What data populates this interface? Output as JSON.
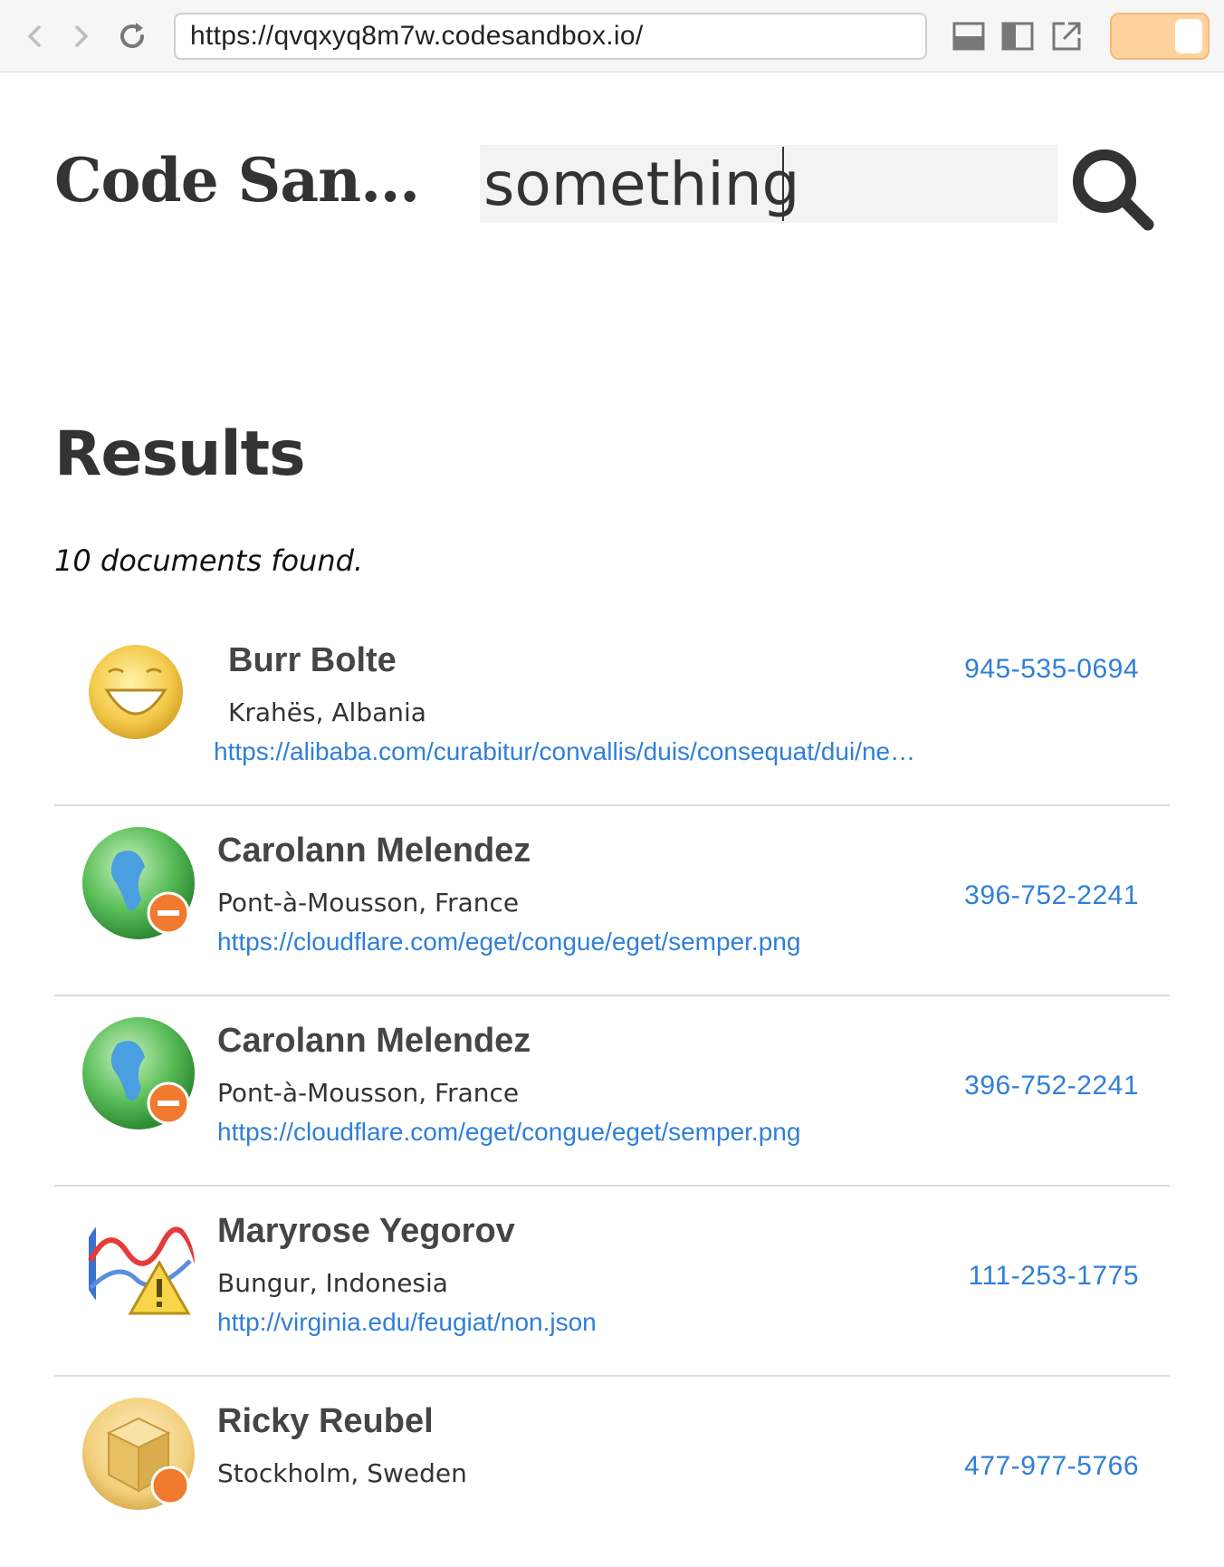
{
  "browser": {
    "url": "https://qvqxyq8m7w.codesandbox.io/"
  },
  "header": {
    "brand": "Code San…",
    "search_value": "something"
  },
  "results": {
    "title": "Results",
    "count_text": "10 documents found.",
    "items": [
      {
        "name": "Burr Bolte",
        "location": "Krahës, Albania",
        "url": "https://alibaba.com/curabitur/convallis/duis/consequat/dui/ne…",
        "phone": "945-535-0694",
        "avatar": "smiley-icon"
      },
      {
        "name": "Carolann Melendez",
        "location": "Pont-à-Mousson, France",
        "url": "https://cloudflare.com/eget/congue/eget/semper.png",
        "phone": "396-752-2241",
        "avatar": "globe-remove-icon"
      },
      {
        "name": "Carolann Melendez",
        "location": "Pont-à-Mousson, France",
        "url": "https://cloudflare.com/eget/congue/eget/semper.png",
        "phone": "396-752-2241",
        "avatar": "globe-remove-icon"
      },
      {
        "name": "Maryrose Yegorov",
        "location": "Bungur, Indonesia",
        "url": "http://virginia.edu/feugiat/non.json",
        "phone": "111-253-1775",
        "avatar": "chart-warning-icon"
      },
      {
        "name": "Ricky Reubel",
        "location": "Stockholm, Sweden",
        "url": "",
        "phone": "477-977-5766",
        "avatar": "box-remove-icon"
      }
    ]
  },
  "colors": {
    "link": "#2f7fd8",
    "toggle": "#ffd39e"
  }
}
